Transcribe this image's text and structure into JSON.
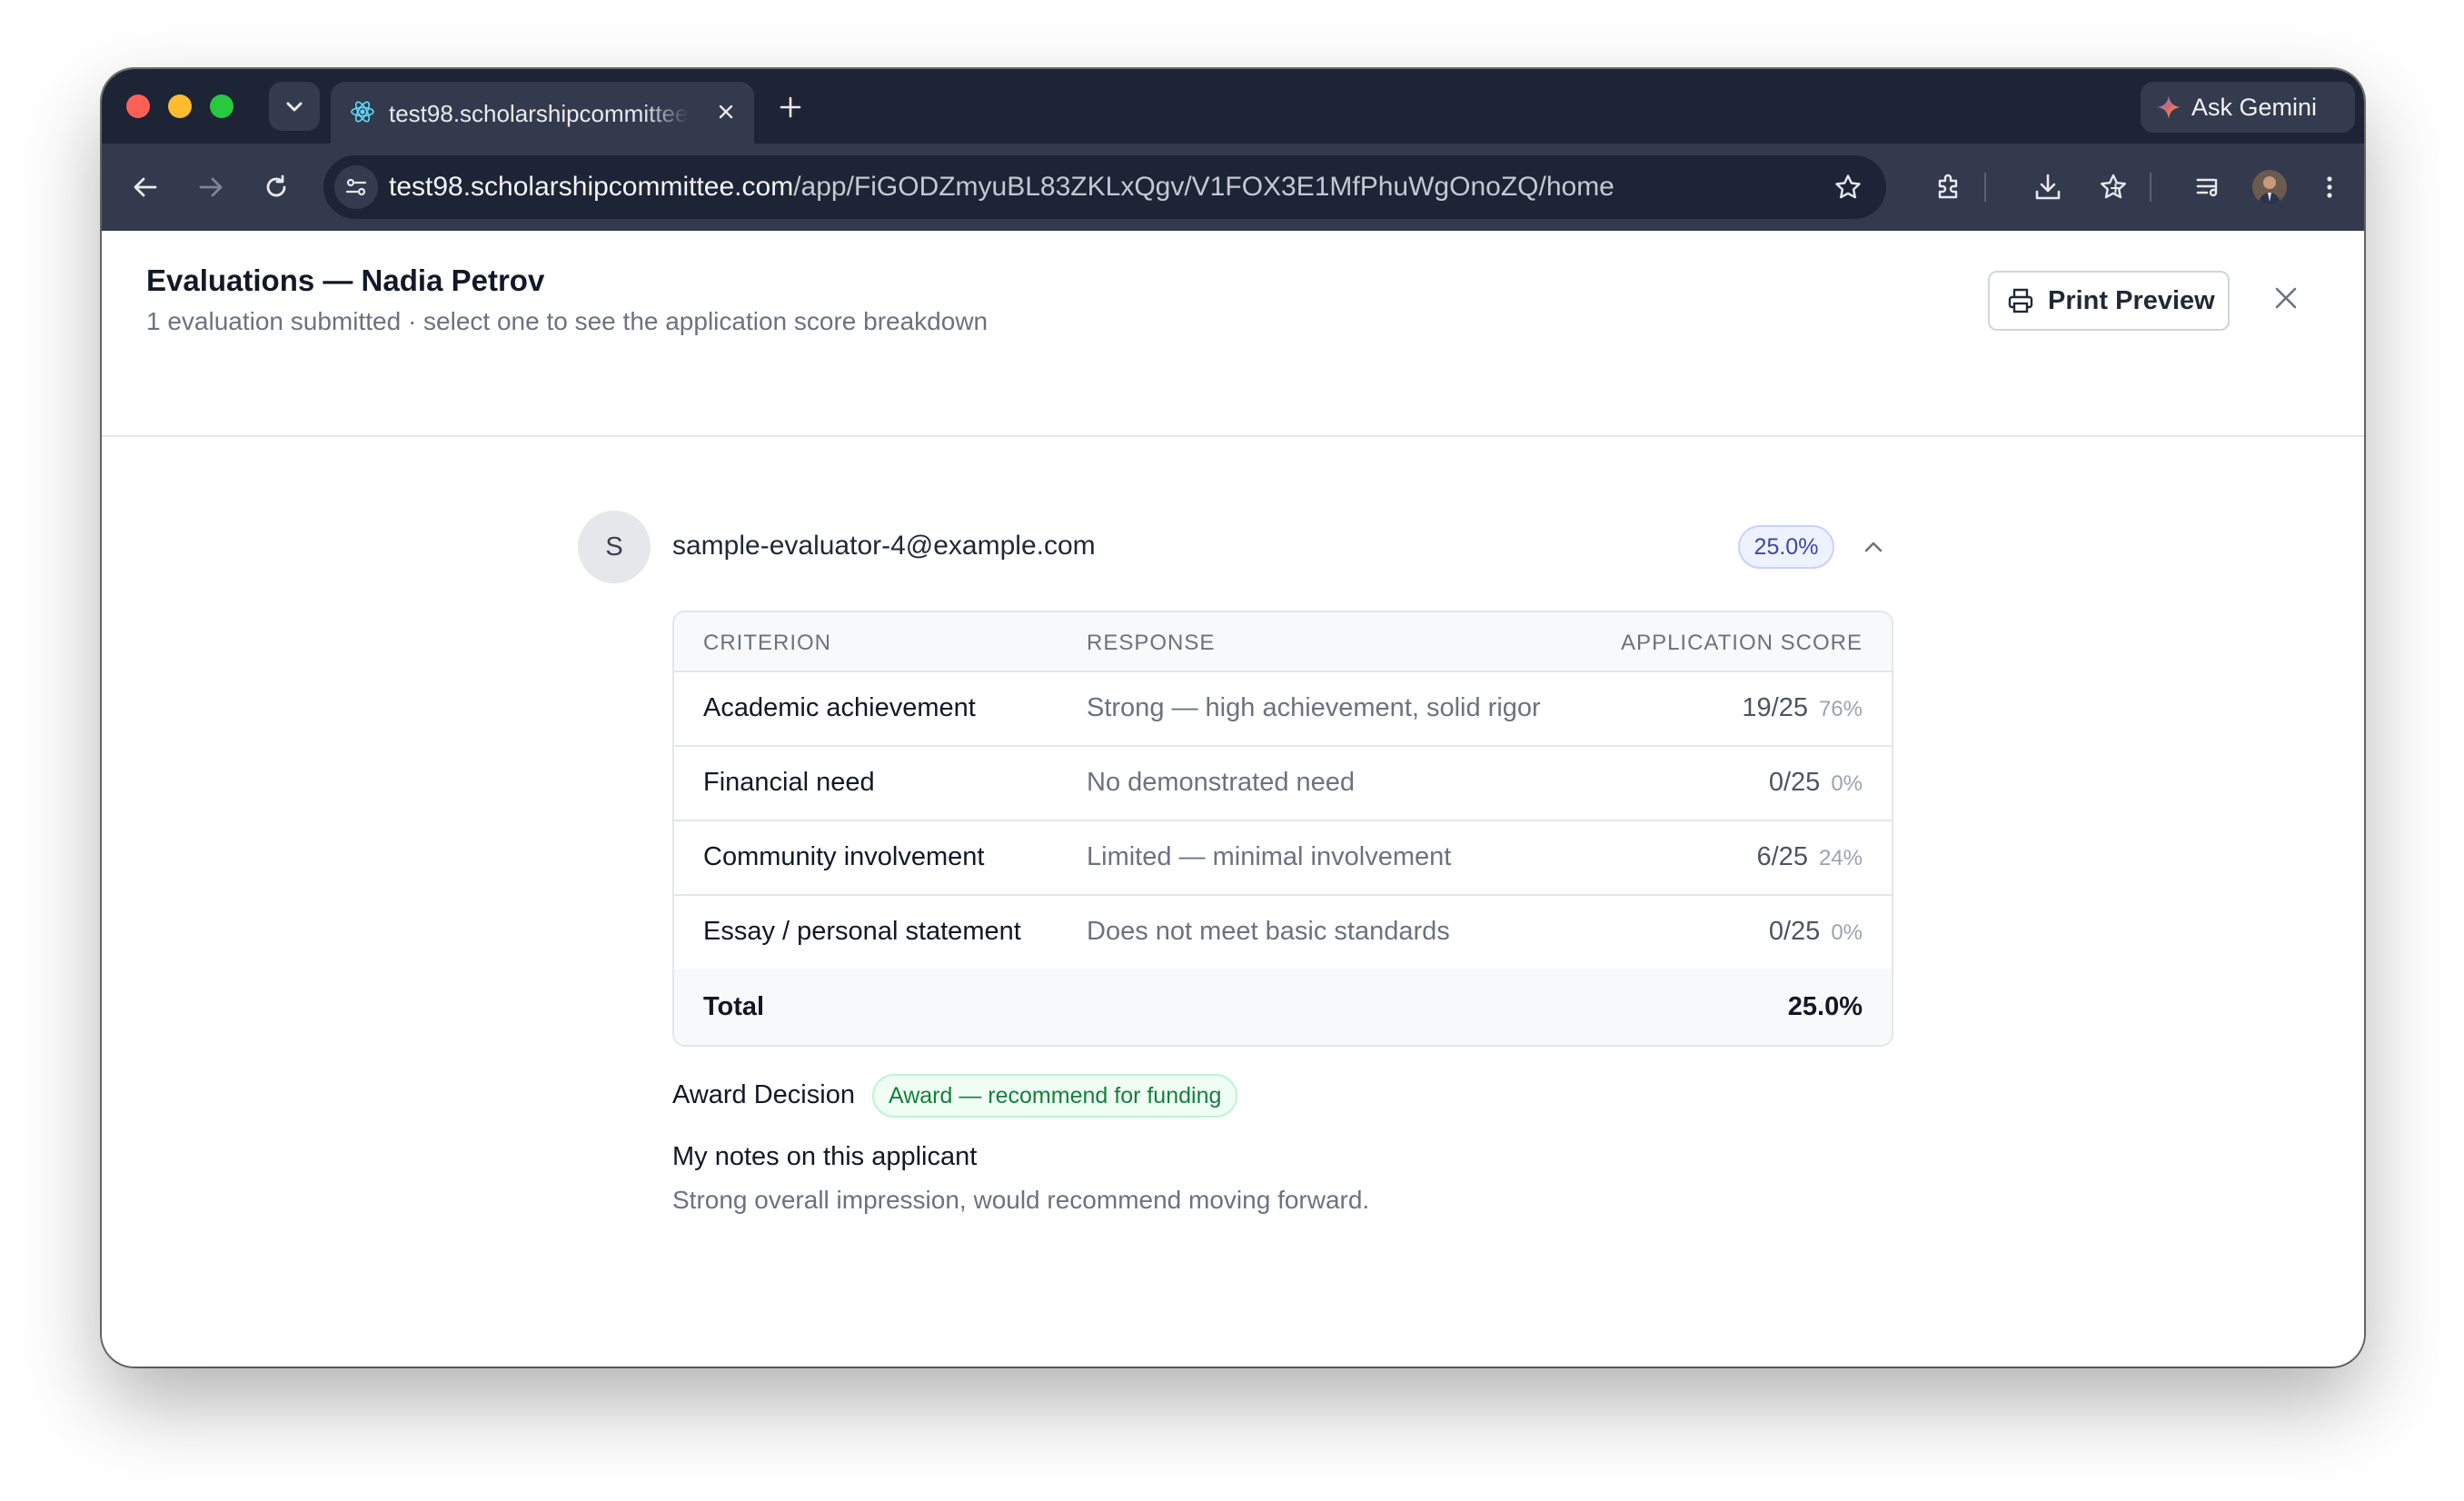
{
  "browser": {
    "tab_title": "test98.scholarshipcommittee.com",
    "url_host": "test98.scholarshipcommittee.com",
    "url_path": "/app/FiGODZmyuBL83ZKLxQgv/V1FOX3E1MfPhuWgOnoZQ/home",
    "gemini_label": "Ask Gemini"
  },
  "header": {
    "title": "Evaluations — Nadia Petrov",
    "subtitle": "1 evaluation submitted · select one to see the application score breakdown",
    "print_label": "Print Preview"
  },
  "evaluation": {
    "avatar_initial": "S",
    "evaluator_email": "sample-evaluator-4@example.com",
    "score_pill": "25.0%",
    "table": {
      "columns": [
        "CRITERION",
        "RESPONSE",
        "APPLICATION SCORE"
      ],
      "rows": [
        {
          "criterion": "Academic achievement",
          "response": "Strong — high achievement, solid rigor",
          "score": "19/25",
          "pct": "76%"
        },
        {
          "criterion": "Financial need",
          "response": "No demonstrated need",
          "score": "0/25",
          "pct": "0%"
        },
        {
          "criterion": "Community involvement",
          "response": "Limited — minimal involvement",
          "score": "6/25",
          "pct": "24%"
        },
        {
          "criterion": "Essay / personal statement",
          "response": "Does not meet basic standards",
          "score": "0/25",
          "pct": "0%"
        }
      ],
      "total_label": "Total",
      "total_value": "25.0%"
    },
    "award_label": "Award Decision",
    "award_value": "Award — recommend for funding",
    "notes_label": "My notes on this applicant",
    "notes_text": "Strong overall impression, would recommend moving forward."
  },
  "colors": {
    "tab_strip": "#1d2436",
    "toolbar": "#333a4d",
    "score_pill_text": "#3b44b0",
    "award_text": "#15803d"
  }
}
